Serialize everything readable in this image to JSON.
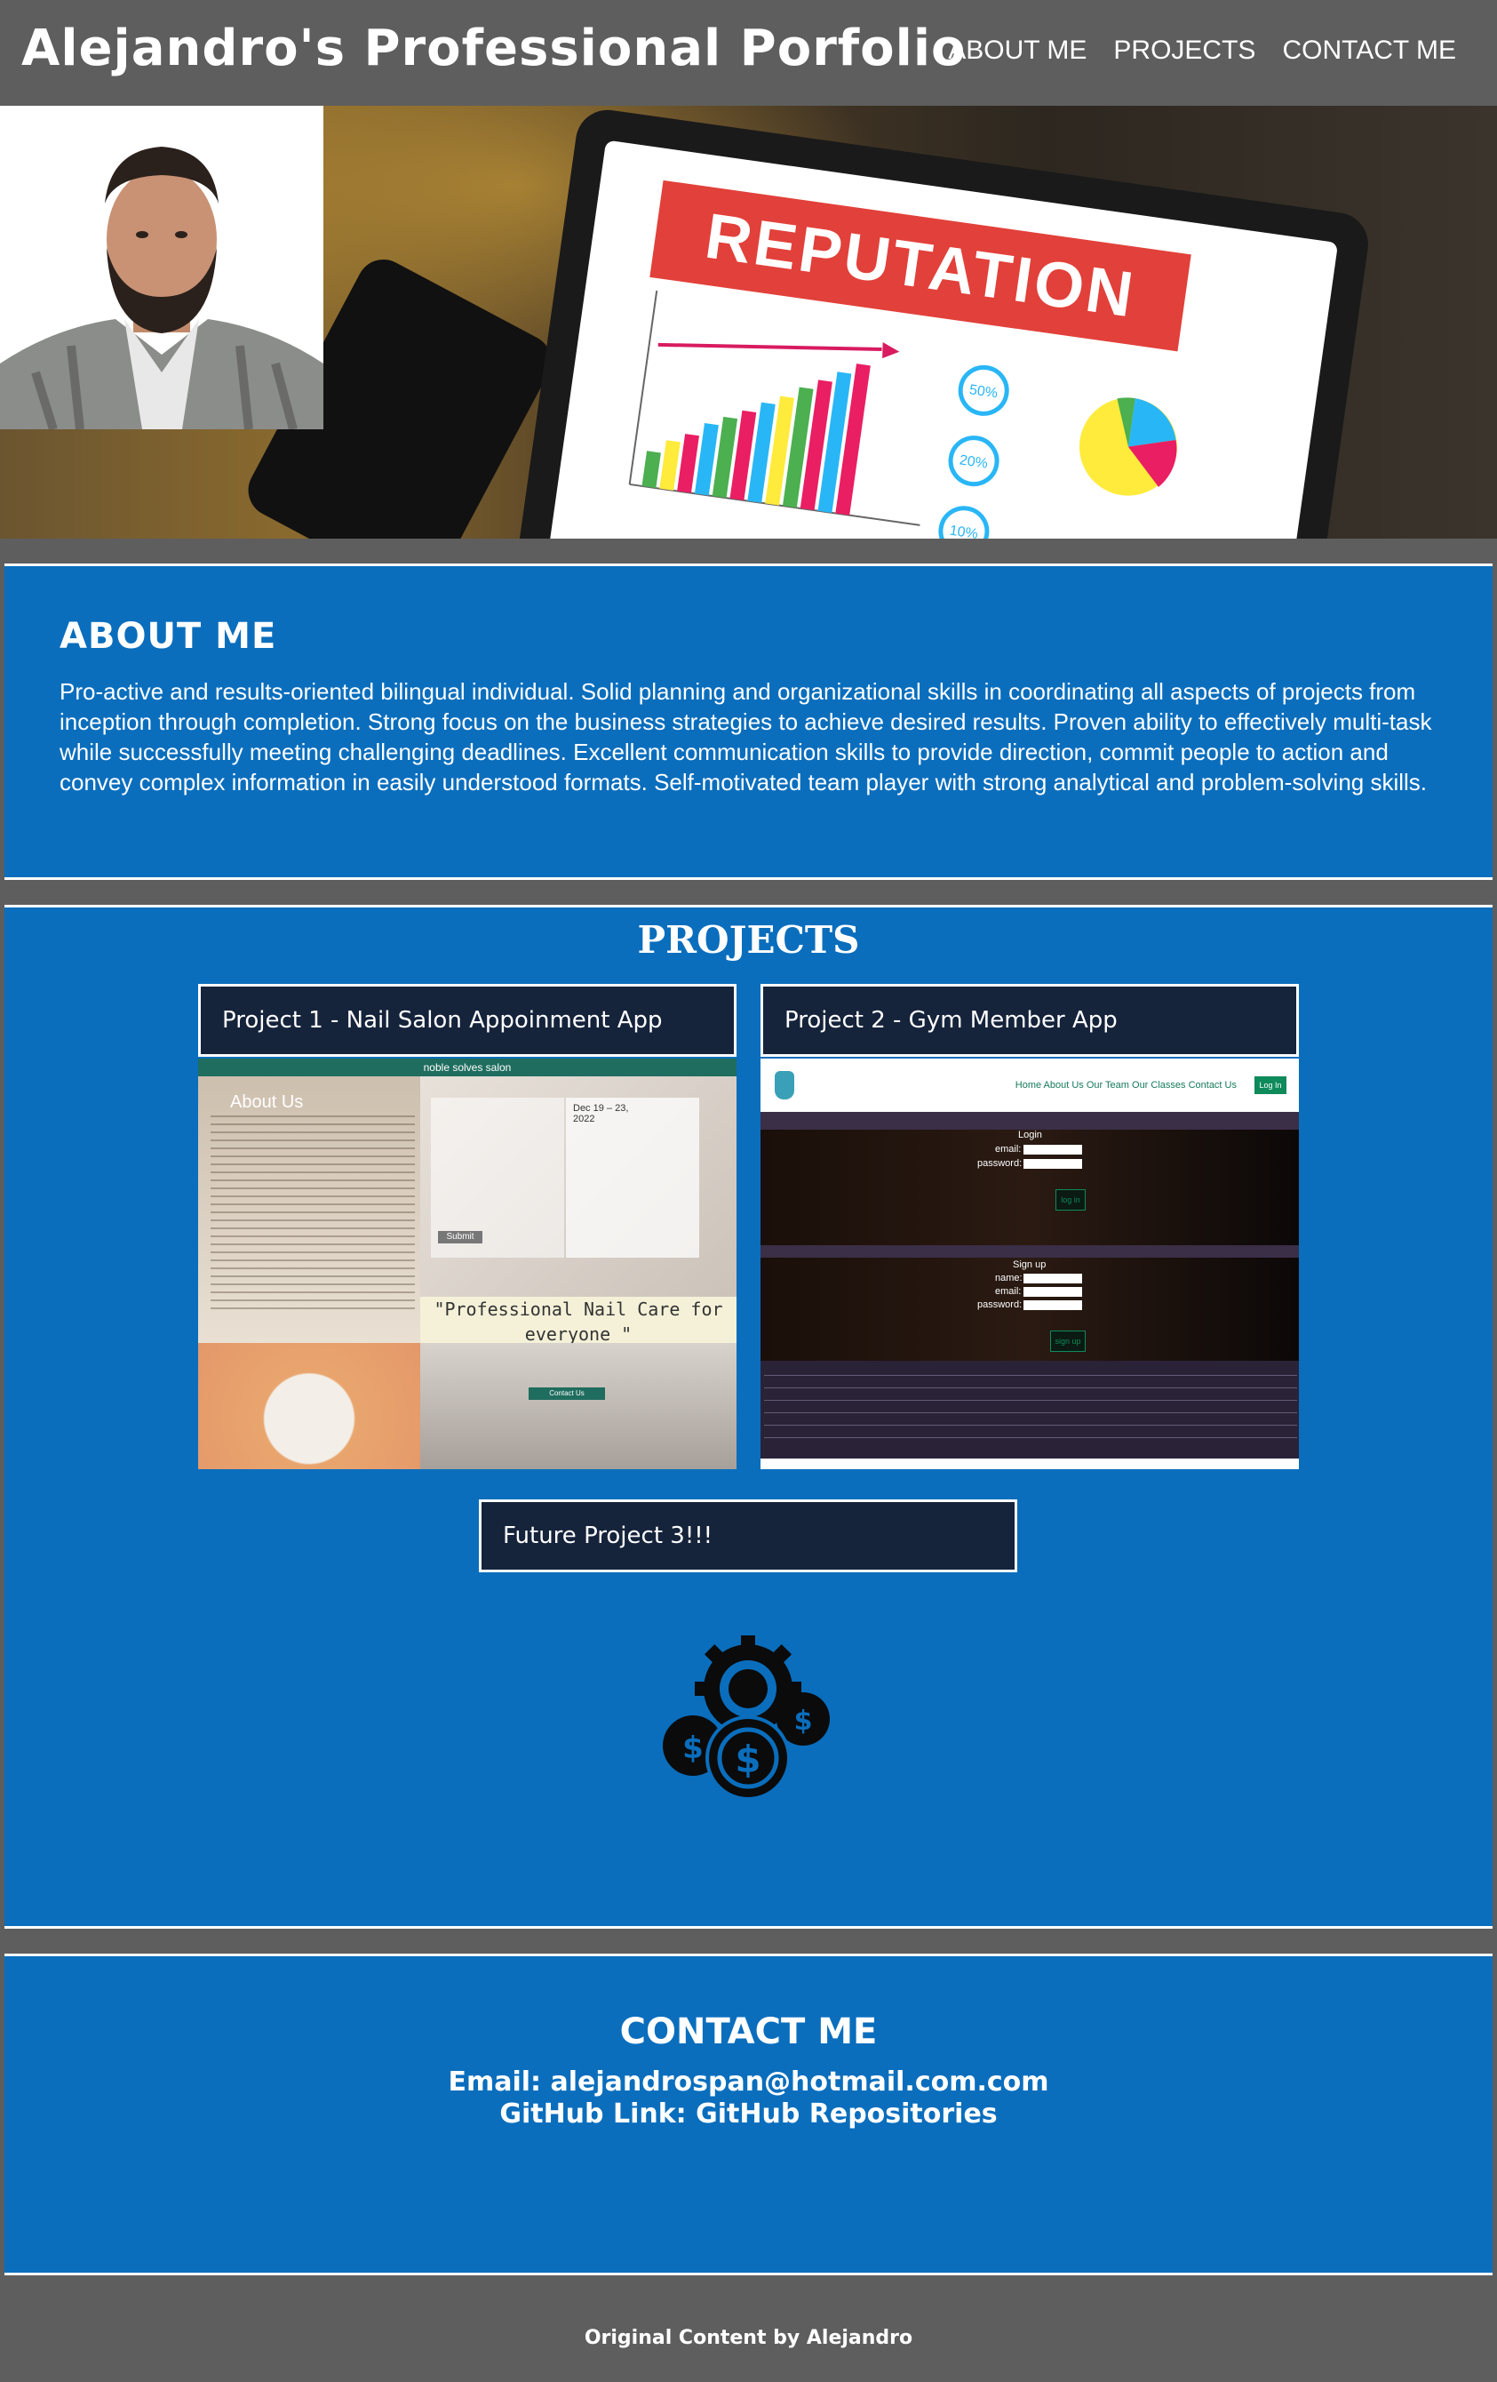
{
  "header": {
    "title": "Alejandro's Professional Porfolio",
    "nav": [
      "ABOUT ME",
      "PROJECTS",
      "CONTACT ME"
    ]
  },
  "hero": {
    "banner_text": "REPUTATION",
    "badges": [
      "50%",
      "20%",
      "10%"
    ]
  },
  "about": {
    "heading": "ABOUT ME",
    "text": "Pro-active and results-oriented bilingual individual. Solid planning and organizational skills in coordinating all aspects of projects from inception through completion. Strong focus on the business strategies to achieve desired results. Proven ability to effectively multi-task while successfully meeting challenging deadlines. Excellent communication skills to provide direction, commit people to action and convey complex information in easily understood formats. Self-motivated team player with strong analytical and problem-solving skills."
  },
  "projects": {
    "heading": "PROJECTS",
    "items": [
      {
        "label": "Project 1 - Nail Salon Appoinment App"
      },
      {
        "label": "Project 2 - Gym Member App"
      },
      {
        "label": "Future Project 3!!!"
      }
    ],
    "nail_shot": {
      "top_bar": "noble solves salon",
      "about_title": "About Us",
      "quote": "\"Professional Nail Care for everyone \"",
      "date_range": "Dec 19 – 23, 2022",
      "submit": "Submit",
      "contact_btn": "Contact Us"
    },
    "gym_shot": {
      "links": "Home   About Us   Our Team   Our Classes   Contact Us",
      "login_btn": "Log In",
      "login_title": "Login",
      "email": "email:",
      "password": "password:",
      "login_submit": "log in",
      "signup_title": "Sign up",
      "name": "name:",
      "signup_submit": "sign up"
    },
    "future_icon": "gear-dollar-icon"
  },
  "contact": {
    "heading": "CONTACT ME",
    "email_line": "Email: alejandrospan@hotmail.com.com",
    "github_line": "GitHub Link: GitHub Repositories"
  },
  "footer": {
    "text": "Original Content by Alejandro"
  },
  "colors": {
    "header_bg": "#5e5e5e",
    "section_bg": "#0a6ebd",
    "card_bg": "#15233b"
  }
}
